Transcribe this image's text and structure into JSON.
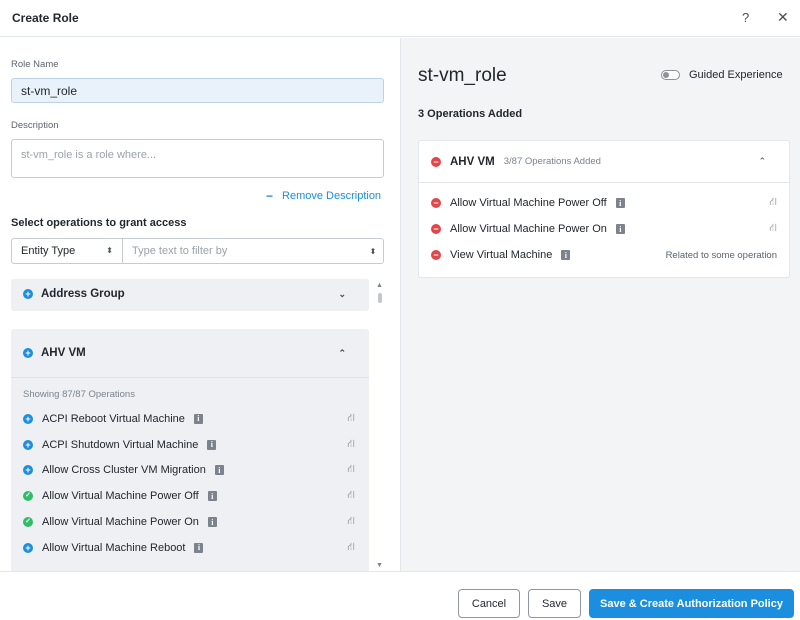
{
  "dialog": {
    "title": "Create Role",
    "help_icon": "?",
    "close_icon": "✕"
  },
  "form": {
    "role_name_label": "Role Name",
    "role_name_value": "st-vm_role",
    "description_label": "Description",
    "description_placeholder": "st-vm_role is a role where...",
    "remove_description": "Remove Description",
    "select_ops_title": "Select operations to grant access",
    "entity_type": "Entity Type",
    "filter_placeholder": "Type text to filter by"
  },
  "groups": {
    "address_group": {
      "name": "Address Group",
      "state": "collapsed"
    },
    "ahv_vm": {
      "name": "AHV VM",
      "state": "expanded",
      "showing": "Showing 87/87 Operations",
      "operations": [
        {
          "name": "ACPI Reboot Virtual Machine",
          "status": "add"
        },
        {
          "name": "ACPI Shutdown Virtual Machine",
          "status": "add"
        },
        {
          "name": "Allow Cross Cluster VM Migration",
          "status": "add"
        },
        {
          "name": "Allow Virtual Machine Power Off",
          "status": "added"
        },
        {
          "name": "Allow Virtual Machine Power On",
          "status": "added"
        },
        {
          "name": "Allow Virtual Machine Reboot",
          "status": "add"
        }
      ]
    }
  },
  "summary": {
    "role_title": "st-vm_role",
    "guided_label": "Guided Experience",
    "guided_on": false,
    "ops_added": "3 Operations Added",
    "entity_name": "AHV VM",
    "entity_count": "3/87 Operations Added",
    "added": [
      {
        "name": "Allow Virtual Machine Power Off",
        "note": ""
      },
      {
        "name": "Allow Virtual Machine Power On",
        "note": ""
      },
      {
        "name": "View Virtual Machine",
        "note": "Related to some operation"
      }
    ]
  },
  "footer": {
    "cancel": "Cancel",
    "save": "Save",
    "save_create": "Save & Create Authorization Policy"
  },
  "colors": {
    "accent": "#1b8ee0",
    "added_green": "#2fbd6a",
    "remove_red": "#e2454a"
  }
}
